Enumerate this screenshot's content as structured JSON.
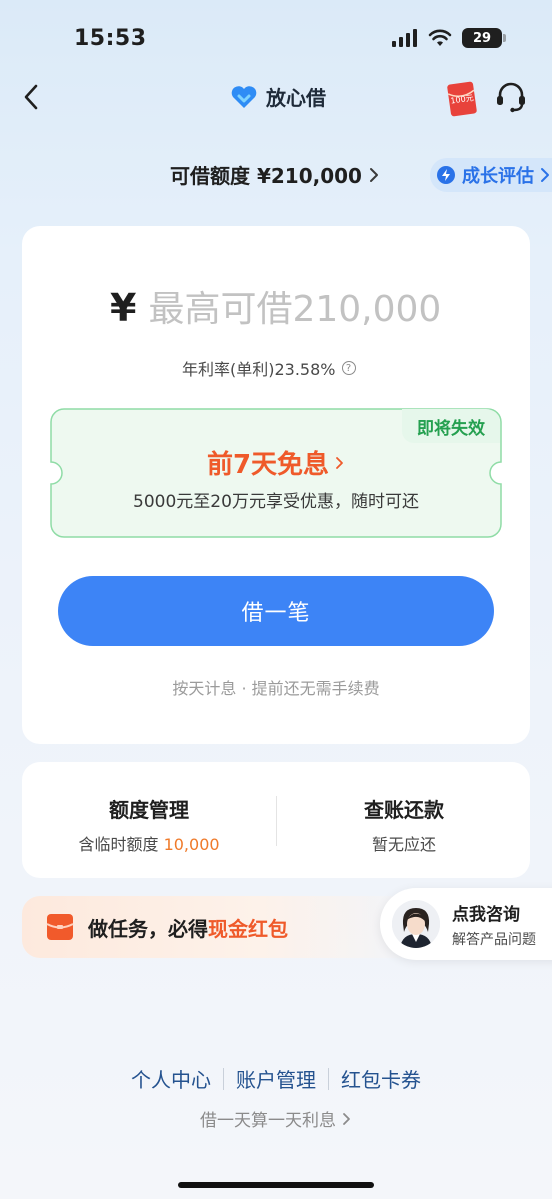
{
  "status_bar": {
    "time": "15:53",
    "battery": "29"
  },
  "nav": {
    "brand": "放心借",
    "gift_text": "100元"
  },
  "limit": {
    "label": "可借额度 ¥210,000",
    "grow_label": "成长评估"
  },
  "main": {
    "currency": "¥",
    "amount_placeholder": "最高可借210,000",
    "rate": "年利率(单利)23.58%",
    "promo": {
      "badge": "即将失效",
      "title": "前7天免息",
      "subtitle": "5000元至20万元享受优惠，随时可还"
    },
    "borrow_button": "借一笔",
    "note": "按天计息 · 提前还无需手续费"
  },
  "manage": {
    "quota": {
      "title": "额度管理",
      "sub_label": "含临时额度",
      "sub_value": "10,000"
    },
    "bill": {
      "title": "查账还款",
      "sub": "暂无应还"
    }
  },
  "task": {
    "text": "做任务，必得",
    "highlight": "现金红包"
  },
  "consult": {
    "title": "点我咨询",
    "sub": "解答产品问题"
  },
  "footer": {
    "links": [
      "个人中心",
      "账户管理",
      "红包卡券"
    ],
    "note": "借一天算一天利息"
  },
  "colors": {
    "primary": "#3d84f6",
    "accent": "#ef5a2a",
    "green": "#25a050"
  },
  "icons": [
    "back-icon",
    "brand-logo-icon",
    "red-packet-icon",
    "customer-service-icon",
    "grow-icon",
    "question-icon",
    "chevron-right-icon",
    "task-gift-icon"
  ]
}
